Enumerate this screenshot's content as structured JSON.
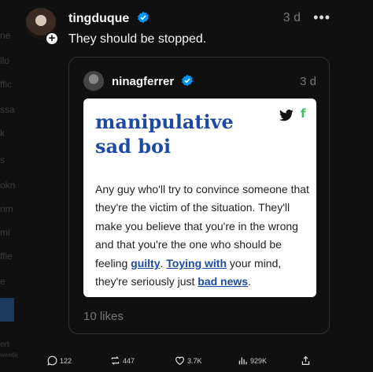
{
  "background_fragments": [
    "ne",
    "llo",
    "ffic",
    "ssa",
    "k",
    "s",
    "okn",
    "nm",
    "mi",
    "ffie",
    "e",
    "ert",
    "weetlight"
  ],
  "post": {
    "author": "tingduque",
    "time": "3 d",
    "more_label": "•••",
    "text": "They should be stopped."
  },
  "quote": {
    "author": "ninagferrer",
    "time": "3 d",
    "likes": "10 likes",
    "card": {
      "title": "manipulative sad boi",
      "def_1": "Any guy who'll try to convince someone that they're the victim of the situation. They'll make you believe that you're in the wrong and that you're the one who should be feeling ",
      "link_guilty": "guilty",
      "def_2": ". ",
      "link_toying": "Toying with",
      "def_3": " your mind, they're seriously just ",
      "link_bad": "bad news",
      "def_4": ".",
      "fb_glyph": "f"
    }
  },
  "actions": {
    "replies": "122",
    "reposts": "447",
    "likes": "3.7K",
    "views": "929K"
  },
  "colors": {
    "background": "#101010",
    "verified": "#0095f6",
    "card_title": "#1d4ba4",
    "facebook_icon": "#3bbf5a"
  },
  "icons": [
    "plus-icon",
    "verified-icon",
    "twitter-icon",
    "facebook-icon",
    "comment-icon",
    "repost-icon",
    "heart-icon",
    "views-icon",
    "share-icon"
  ]
}
